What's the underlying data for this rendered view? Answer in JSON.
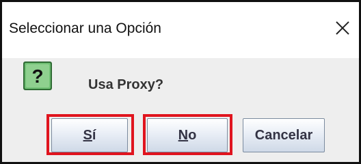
{
  "dialog": {
    "title": "Seleccionar una Opción",
    "message": "Usa Proxy?",
    "question_glyph": "?",
    "buttons": {
      "yes": {
        "mnemonic": "S",
        "rest": "í"
      },
      "no": {
        "mnemonic": "N",
        "rest": "o"
      },
      "cancel": {
        "label": "Cancelar"
      }
    }
  },
  "icons": {
    "close": "close-icon",
    "question": "question-icon"
  },
  "colors": {
    "highlight": "#e0141e",
    "question_icon_bg": "#6fbf73",
    "dialog_bg": "#eeeeee"
  }
}
